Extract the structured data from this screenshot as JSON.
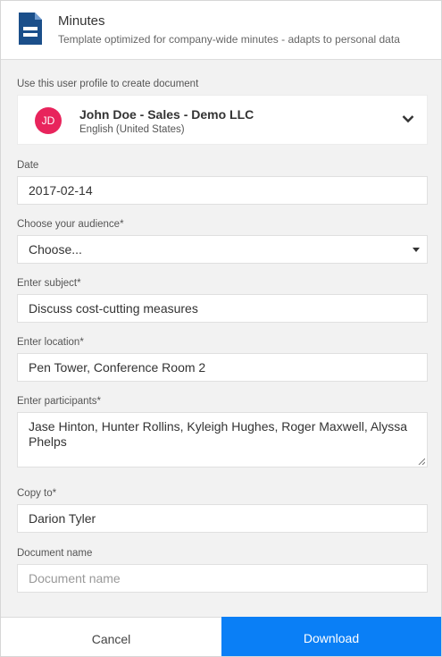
{
  "header": {
    "title": "Minutes",
    "subtitle": "Template optimized for company-wide minutes - adapts to personal data",
    "icon": "document-template-icon",
    "icon_color": "#1b4f8a"
  },
  "profile": {
    "label": "Use this user profile to create document",
    "initials": "JD",
    "name": "John Doe - Sales - Demo LLC",
    "language": "English (United States)",
    "avatar_color": "#e8245c"
  },
  "date": {
    "label": "Date",
    "value": "2017-02-14"
  },
  "audience": {
    "label": "Choose your audience*",
    "value": "Choose..."
  },
  "subject": {
    "label": "Enter subject*",
    "value": "Discuss cost-cutting measures"
  },
  "location": {
    "label": "Enter location*",
    "value": "Pen Tower, Conference Room 2"
  },
  "participants": {
    "label": "Enter participants*",
    "value": "Jase Hinton, Hunter Rollins, Kyleigh Hughes, Roger Maxwell, Alyssa Phelps"
  },
  "copy_to": {
    "label": "Copy to*",
    "value": "Darion Tyler"
  },
  "document_name": {
    "label": "Document name",
    "placeholder": "Document name"
  },
  "footer": {
    "cancel_label": "Cancel",
    "download_label": "Download",
    "download_color": "#0a7ff6"
  }
}
